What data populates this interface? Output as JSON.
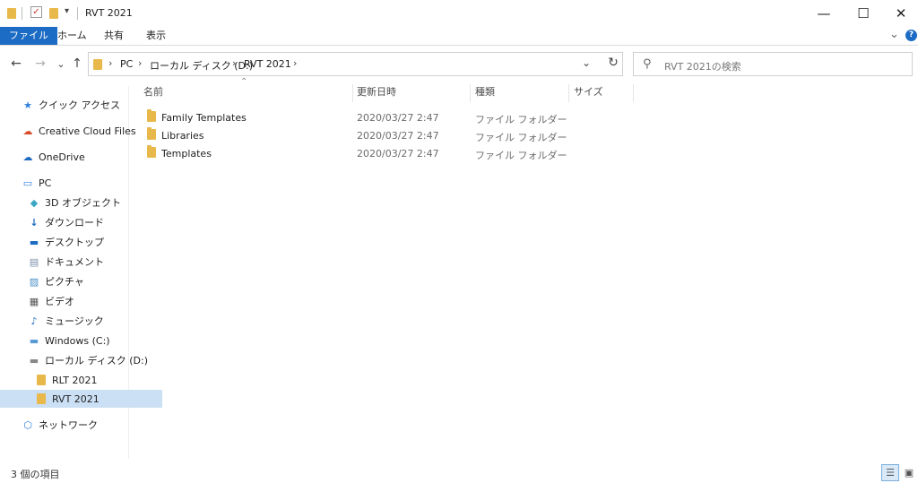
{
  "window": {
    "title": "RVT 2021",
    "minimize": "—",
    "maximize": "☐",
    "close": "✕",
    "qa_dropdown": "▾"
  },
  "ribbon": {
    "tabs": [
      "ファイル",
      "ホーム",
      "共有",
      "表示"
    ],
    "expand": "⌄",
    "help": "?"
  },
  "nav": {
    "back": "←",
    "forward": "→",
    "recent": "⌄",
    "up": "↑",
    "refresh": "↻",
    "dropdown": "⌄"
  },
  "address": {
    "segments": [
      "PC",
      "ローカル ディスク (D:)",
      "RVT 2021"
    ],
    "separator": "›"
  },
  "search": {
    "placeholder": "RVT 2021の検索",
    "icon": "⚲"
  },
  "sidebar": {
    "items": [
      {
        "label": "クイック アクセス",
        "icon": "★"
      },
      {
        "label": "Creative Cloud Files",
        "icon": "☁"
      },
      {
        "label": "OneDrive",
        "icon": "☁"
      },
      {
        "label": "PC",
        "icon": "▭"
      },
      {
        "label": "3D オブジェクト",
        "icon": "◆"
      },
      {
        "label": "ダウンロード",
        "icon": "↓"
      },
      {
        "label": "デスクトップ",
        "icon": "▬"
      },
      {
        "label": "ドキュメント",
        "icon": "▤"
      },
      {
        "label": "ピクチャ",
        "icon": "▨"
      },
      {
        "label": "ビデオ",
        "icon": "▦"
      },
      {
        "label": "ミュージック",
        "icon": "♪"
      },
      {
        "label": "Windows (C:)",
        "icon": "▬"
      },
      {
        "label": "ローカル ディスク (D:)",
        "icon": "▬"
      },
      {
        "label": "RLT 2021",
        "icon": ""
      },
      {
        "label": "RVT 2021",
        "icon": ""
      },
      {
        "label": "ネットワーク",
        "icon": "⬡"
      }
    ]
  },
  "columns": {
    "name": "名前",
    "date": "更新日時",
    "type": "種類",
    "size": "サイズ",
    "sort_indicator": "⌃"
  },
  "files": [
    {
      "name": "Family Templates",
      "date": "2020/03/27 2:47",
      "type": "ファイル フォルダー"
    },
    {
      "name": "Libraries",
      "date": "2020/03/27 2:47",
      "type": "ファイル フォルダー"
    },
    {
      "name": "Templates",
      "date": "2020/03/27 2:47",
      "type": "ファイル フォルダー"
    }
  ],
  "status": {
    "count": "3 個の項目",
    "details_view": "☰",
    "tiles_view": "▣"
  },
  "colors": {
    "accent": "#1c6bc4",
    "folder": "#e8b84a",
    "selected": "#cce0f5"
  }
}
